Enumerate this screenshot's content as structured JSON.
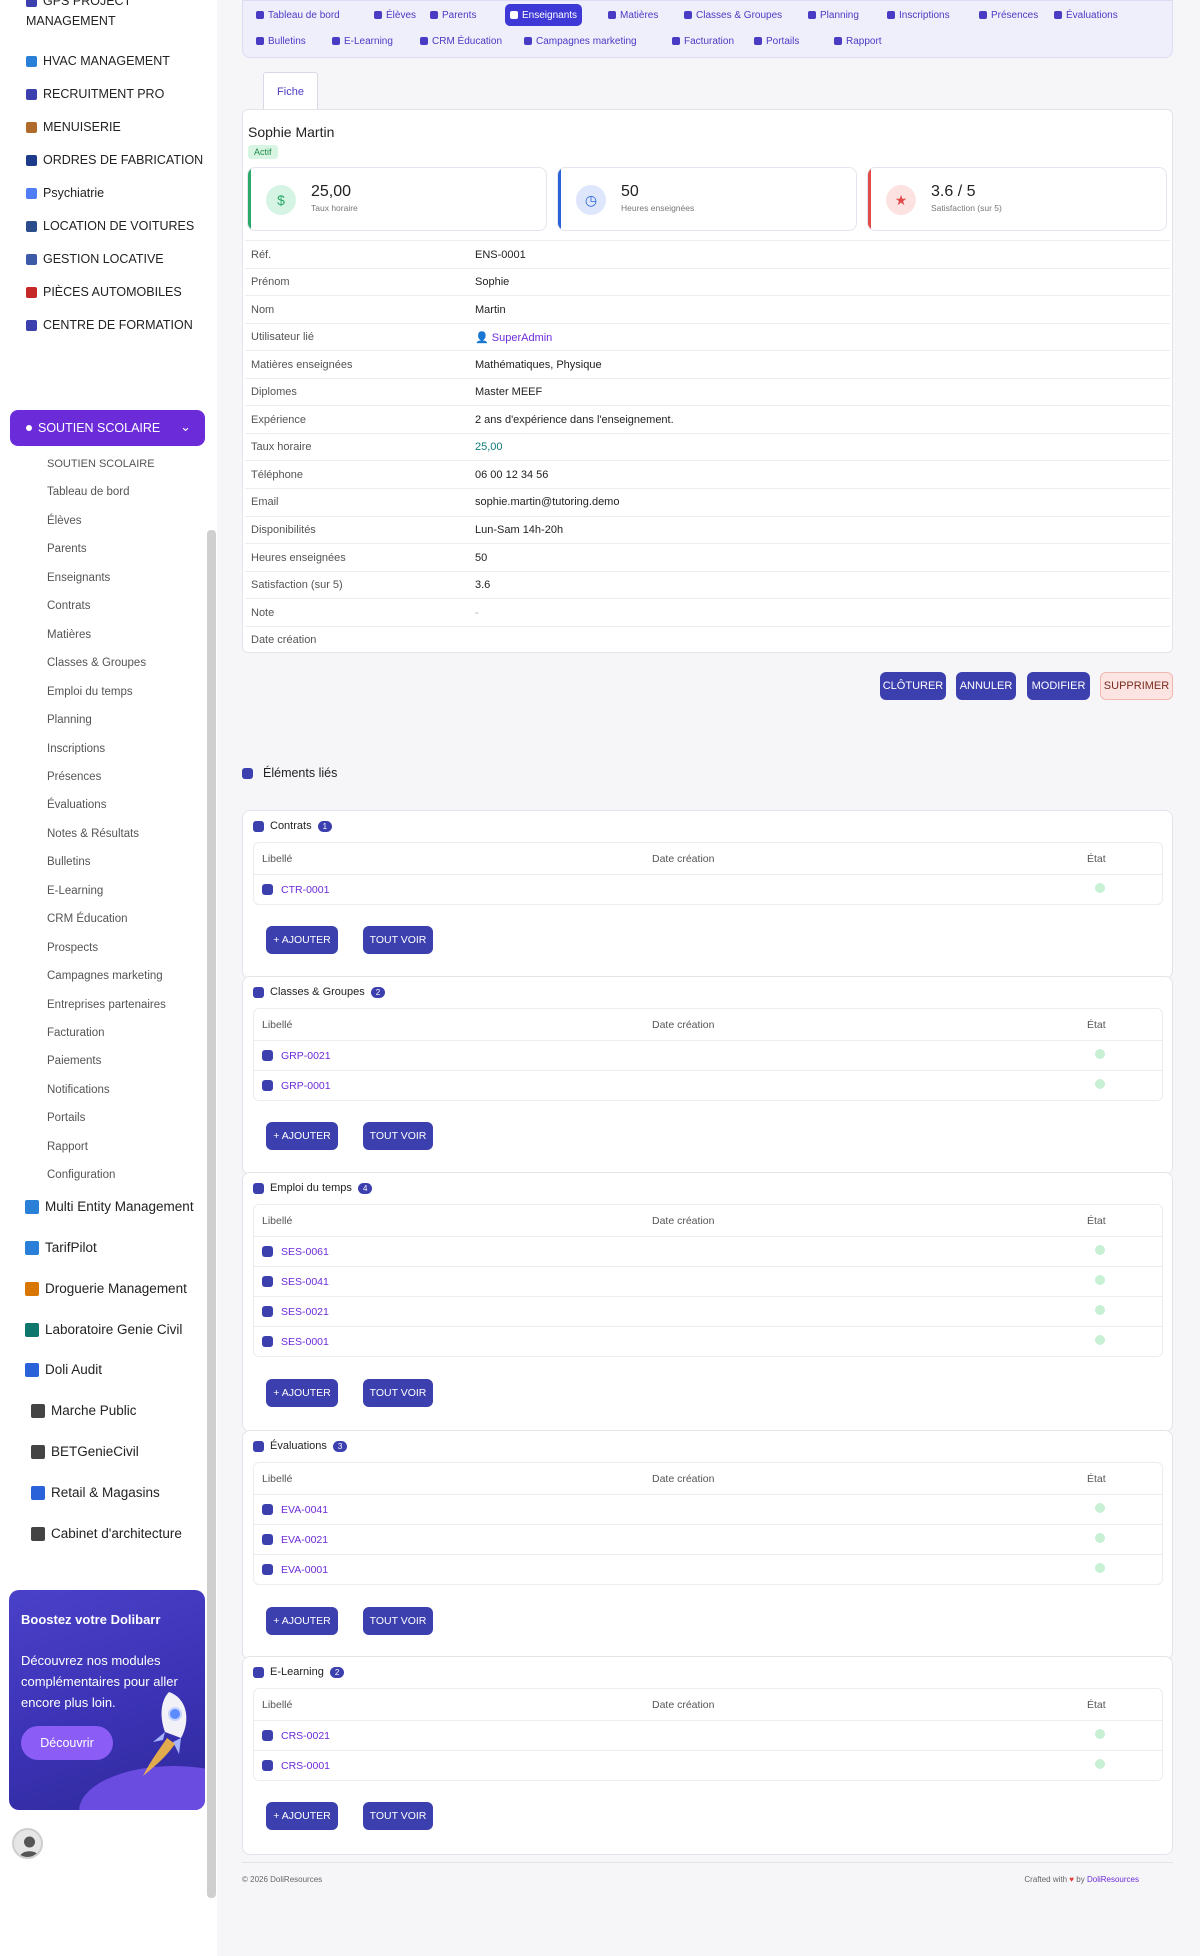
{
  "sidebar": {
    "top_truncated": "GPS PROJECT",
    "top_module": "MANAGEMENT",
    "modules_upper": [
      "HVAC MANAGEMENT",
      "RECRUITMENT PRO",
      "MENUISERIE",
      "ORDRES DE FABRICATION",
      "Psychiatrie",
      "LOCATION DE VOITURES",
      "GESTION LOCATIVE",
      "PIÈCES AUTOMOBILES",
      "CENTRE DE FORMATION"
    ],
    "active_module": "SOUTIEN SCOLAIRE",
    "submenu": [
      "SOUTIEN SCOLAIRE",
      "Tableau de bord",
      "Élèves",
      "Parents",
      "Enseignants",
      "Contrats",
      "Matières",
      "Classes & Groupes",
      "Emploi du temps",
      "Planning",
      "Inscriptions",
      "Présences",
      "Évaluations",
      "Notes & Résultats",
      "Bulletins",
      "E-Learning",
      "CRM Éducation",
      "Prospects",
      "Campagnes marketing",
      "Entreprises partenaires",
      "Facturation",
      "Paiements",
      "Notifications",
      "Portails",
      "Rapport",
      "Configuration"
    ],
    "modules_lower": [
      "Multi Entity Management",
      "TarifPilot",
      "Droguerie Management",
      "Laboratoire Genie Civil",
      "Doli Audit",
      "Marche Public",
      "BETGenieCivil",
      "Retail & Magasins",
      "Cabinet d'architecture"
    ],
    "promo": {
      "title": "Boostez votre Dolibarr",
      "description": "Découvrez nos modules complémentaires pour aller encore plus loin.",
      "button": "Découvrir"
    }
  },
  "topmenu": {
    "row1": [
      "Tableau de bord",
      "Élèves",
      "Parents",
      "Enseignants",
      "Matières",
      "Classes & Groupes",
      "Planning",
      "Inscriptions",
      "Présences",
      "Évaluations"
    ],
    "row2": [
      "Bulletins",
      "E-Learning",
      "CRM Éducation",
      "Campagnes marketing",
      "Facturation",
      "Portails",
      "Rapport"
    ],
    "active": "Enseignants"
  },
  "tab": "Fiche",
  "record": {
    "name": "Sophie Martin",
    "status": "Actif",
    "kpis": [
      {
        "value": "25,00",
        "label": "Taux horaire",
        "color": "#2aa86a"
      },
      {
        "value": "50",
        "label": "Heures enseignées",
        "color": "#2962d9"
      },
      {
        "value": "3.6 / 5",
        "label": "Satisfaction (sur 5)",
        "color": "#e34a4a"
      }
    ],
    "fields": [
      {
        "k": "Réf.",
        "v": "ENS-0001"
      },
      {
        "k": "Prénom",
        "v": "Sophie"
      },
      {
        "k": "Nom",
        "v": "Martin"
      },
      {
        "k": "Utilisateur lié",
        "v": "SuperAdmin"
      },
      {
        "k": "Matières enseignées",
        "v": "Mathématiques, Physique"
      },
      {
        "k": "Diplomes",
        "v": "Master MEEF"
      },
      {
        "k": "Expérience",
        "v": "2 ans d'expérience dans l'enseignement."
      },
      {
        "k": "Taux horaire",
        "v": "25,00"
      },
      {
        "k": "Téléphone",
        "v": "06 00 12 34 56"
      },
      {
        "k": "Email",
        "v": "sophie.martin@tutoring.demo"
      },
      {
        "k": "Disponibilités",
        "v": "Lun-Sam 14h-20h"
      },
      {
        "k": "Heures enseignées",
        "v": "50"
      },
      {
        "k": "Satisfaction (sur 5)",
        "v": "3.6"
      },
      {
        "k": "Note",
        "v": "-"
      },
      {
        "k": "Date création",
        "v": ""
      }
    ]
  },
  "actions": {
    "close": "CLÔTURER",
    "cancel": "ANNULER",
    "edit": "MODIFIER",
    "delete": "SUPPRIMER"
  },
  "linked": {
    "title": "Éléments liés",
    "columns": {
      "label": "Libellé",
      "date": "Date création",
      "state": "État"
    },
    "add": "+ AJOUTER",
    "view_all": "TOUT VOIR",
    "sections": [
      {
        "title": "Contrats",
        "count": "1",
        "rows": [
          "CTR-0001"
        ]
      },
      {
        "title": "Classes & Groupes",
        "count": "2",
        "rows": [
          "GRP-0021",
          "GRP-0001"
        ]
      },
      {
        "title": "Emploi du temps",
        "count": "4",
        "rows": [
          "SES-0061",
          "SES-0041",
          "SES-0021",
          "SES-0001"
        ]
      },
      {
        "title": "Évaluations",
        "count": "3",
        "rows": [
          "EVA-0041",
          "EVA-0021",
          "EVA-0001"
        ]
      },
      {
        "title": "E-Learning",
        "count": "2",
        "rows": [
          "CRS-0021",
          "CRS-0001"
        ]
      }
    ]
  },
  "footer": {
    "copyright": "© 2026 DoliResources",
    "crafted": "Crafted with",
    "by": "by",
    "brand": "DoliResources"
  }
}
